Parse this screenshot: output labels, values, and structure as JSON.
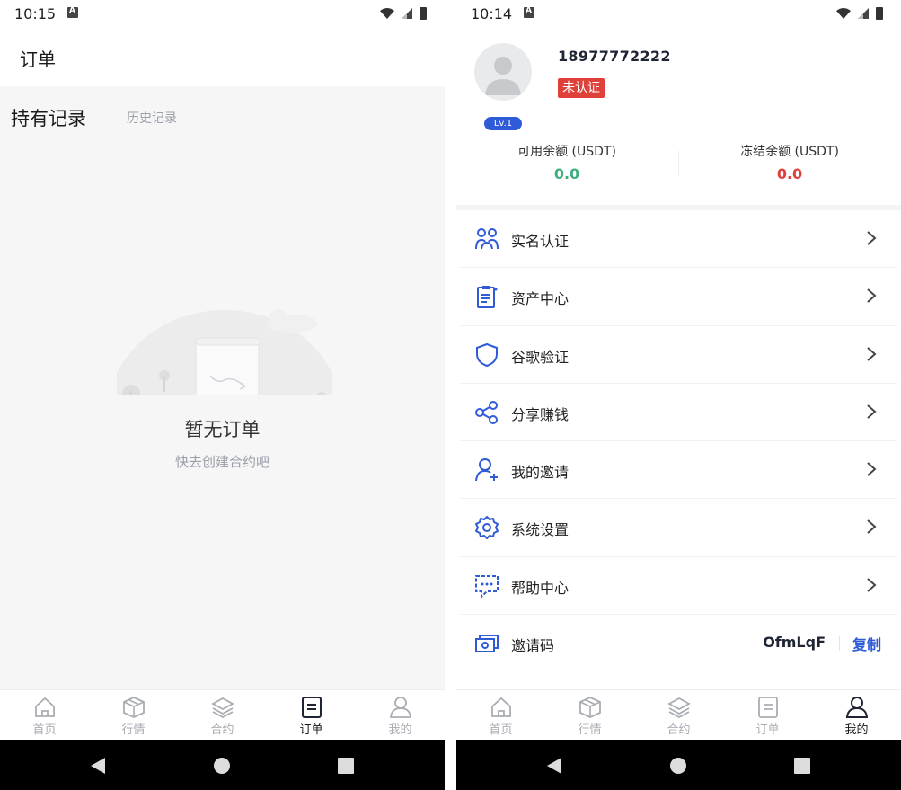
{
  "left": {
    "status": {
      "time": "10:15"
    },
    "header": {
      "title": "订单"
    },
    "subtabs": {
      "active": "持有记录",
      "inactive": "历史记录"
    },
    "empty": {
      "title": "暂无订单",
      "subtitle": "快去创建合约吧"
    },
    "tabs": [
      {
        "label": "首页",
        "icon": "home-icon",
        "active": false
      },
      {
        "label": "行情",
        "icon": "cube-icon",
        "active": false
      },
      {
        "label": "合约",
        "icon": "layers-icon",
        "active": false
      },
      {
        "label": "订单",
        "icon": "document-icon",
        "active": true
      },
      {
        "label": "我的",
        "icon": "user-icon",
        "active": false
      }
    ]
  },
  "right": {
    "status": {
      "time": "10:14"
    },
    "profile": {
      "phone": "18977772222",
      "level": "Lv.1",
      "verification": "未认证"
    },
    "balances": [
      {
        "label": "可用余额 (USDT)",
        "value": "0.0",
        "color": "#3fae7d"
      },
      {
        "label": "冻结余额 (USDT)",
        "value": "0.0",
        "color": "#e0403a"
      }
    ],
    "menu": [
      {
        "label": "实名认证",
        "icon": "users-icon"
      },
      {
        "label": "资产中心",
        "icon": "clipboard-icon"
      },
      {
        "label": "谷歌验证",
        "icon": "shield-icon"
      },
      {
        "label": "分享赚钱",
        "icon": "share-icon"
      },
      {
        "label": "我的邀请",
        "icon": "user-plus-icon"
      },
      {
        "label": "系统设置",
        "icon": "gear-icon"
      },
      {
        "label": "帮助中心",
        "icon": "chat-icon"
      }
    ],
    "invite": {
      "label": "邀请码",
      "icon": "ticket-icon",
      "code": "OfmLqF",
      "copy_label": "复制"
    },
    "tabs": [
      {
        "label": "首页",
        "icon": "home-icon",
        "active": false
      },
      {
        "label": "行情",
        "icon": "cube-icon",
        "active": false
      },
      {
        "label": "合约",
        "icon": "layers-icon",
        "active": false
      },
      {
        "label": "订单",
        "icon": "document-icon",
        "active": false
      },
      {
        "label": "我的",
        "icon": "user-icon",
        "active": true
      }
    ]
  },
  "colors": {
    "accent": "#2f5bd8",
    "green": "#3fae7d",
    "red": "#e0403a",
    "inactive": "#a9adb3"
  }
}
